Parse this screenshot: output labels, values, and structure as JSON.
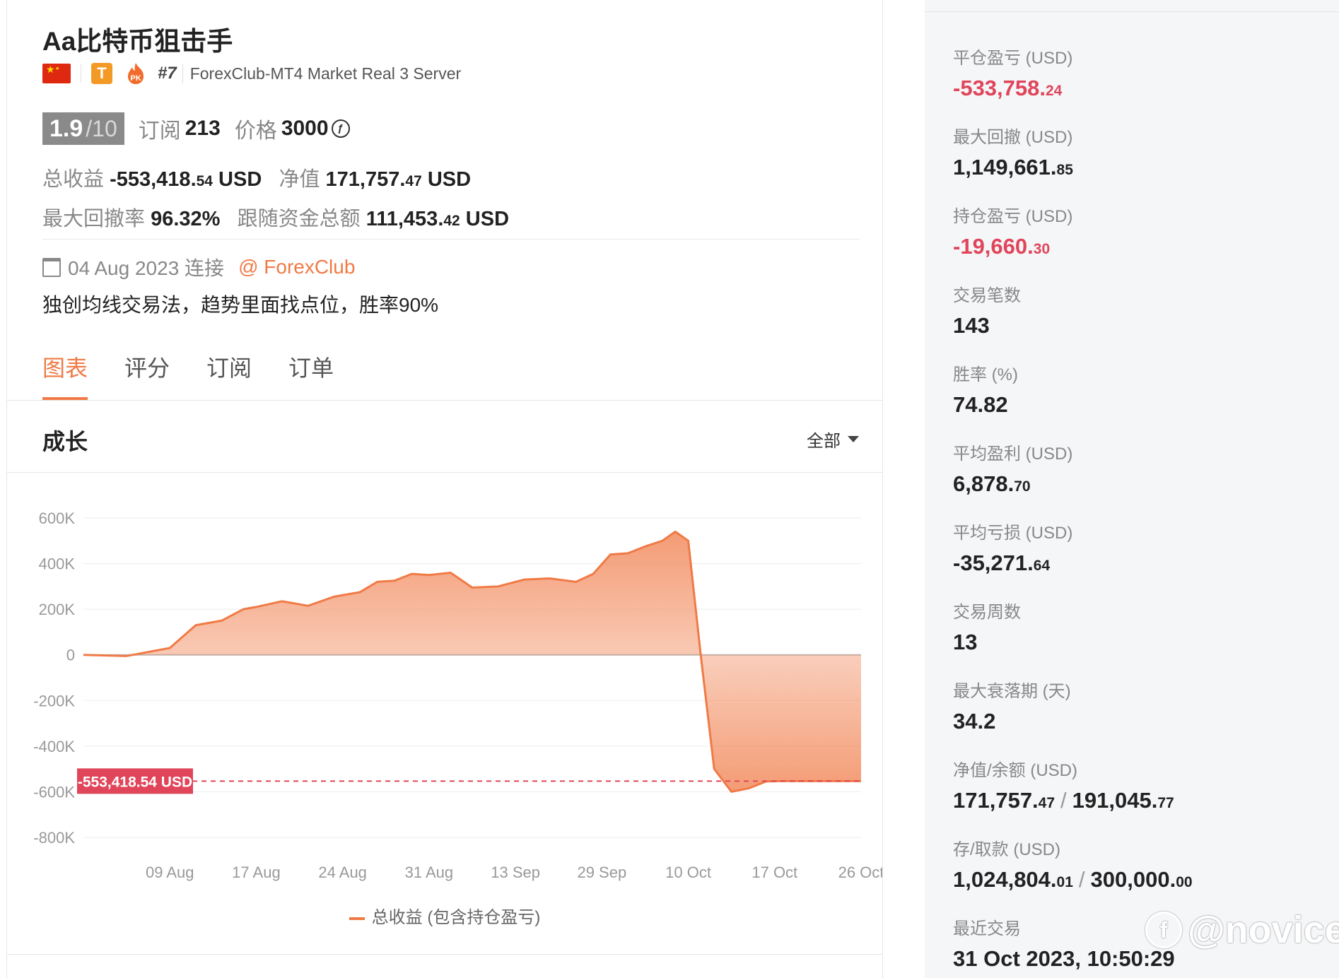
{
  "profile": {
    "title": "Aa比特币狙击手",
    "flag_icon": "china-flag-icon",
    "tier_badge": "T",
    "pk_badge": "PK",
    "rank": "#7",
    "server": "ForexClub-MT4 Market Real 3 Server",
    "score": "1.9",
    "score_max": "/10",
    "subscribe_label": "订阅",
    "subscribe_count": "213",
    "price_label": "价格",
    "price_value": "3000",
    "total_profit_label": "总收益",
    "total_profit_main": "-553,418.",
    "total_profit_dec": "54",
    "total_profit_unit": "USD",
    "equity_label": "净值",
    "equity_main": "171,757.",
    "equity_dec": "47",
    "equity_unit": "USD",
    "max_dd_label": "最大回撤率",
    "max_dd_value": "96.32%",
    "follow_funds_label": "跟随资金总额",
    "follow_funds_main": "111,453.",
    "follow_funds_dec": "42",
    "follow_funds_unit": "USD",
    "connect_date": "04 Aug 2023 连接",
    "broker": "@ ForexClub",
    "description": "独创均线交易法，趋势里面找点位，胜率90%"
  },
  "tabs": [
    "图表",
    "评分",
    "订阅",
    "订单"
  ],
  "active_tab": 0,
  "section": {
    "title": "成长",
    "range_label": "全部"
  },
  "colors": {
    "accent": "#f07a46",
    "negative": "#e0455a",
    "line": "#f07a46",
    "marker_bg": "#e0455a"
  },
  "chart_data": {
    "type": "area",
    "title": "",
    "xlabel": "",
    "ylabel": "",
    "ylim": [
      -800000,
      600000
    ],
    "yticks": [
      600000,
      400000,
      200000,
      0,
      -200000,
      -400000,
      -600000,
      -800000
    ],
    "ytick_labels": [
      "600K",
      "400K",
      "200K",
      "0",
      "-200K",
      "-400K",
      "-600K",
      "-800K"
    ],
    "xtick_labels": [
      "09 Aug",
      "17 Aug",
      "24 Aug",
      "31 Aug",
      "13 Sep",
      "29 Sep",
      "10 Oct",
      "17 Oct",
      "26 Oct"
    ],
    "series": [
      {
        "name": "总收益 (包含持仓盈亏)",
        "x": [
          0,
          0.5,
          1,
          1.3,
          1.6,
          1.85,
          2,
          2.3,
          2.6,
          2.9,
          3.2,
          3.4,
          3.6,
          3.8,
          4,
          4.25,
          4.5,
          4.8,
          5,
          5.1,
          5.4,
          5.7,
          5.9,
          6.1,
          6.3,
          6.5,
          6.7,
          6.85,
          7,
          7.15,
          7.3,
          7.5,
          7.7,
          7.9,
          8.05,
          8.15,
          8.2,
          8.3,
          8.5,
          8.7,
          8.9,
          9
        ],
        "y": [
          0,
          -5000,
          30000,
          130000,
          150000,
          200000,
          210000,
          235000,
          215000,
          255000,
          275000,
          320000,
          325000,
          355000,
          350000,
          360000,
          295000,
          300000,
          320000,
          330000,
          335000,
          320000,
          355000,
          440000,
          445000,
          475000,
          500000,
          540000,
          500000,
          -20000,
          -500000,
          -600000,
          -585000,
          -555000,
          -553418.54,
          -553418.54,
          -553418.54,
          -553418.54,
          -553418.54,
          -553418.54,
          -553418.54,
          -553418.54
        ]
      }
    ],
    "current_value_label": "-553,418.54 USD",
    "current_value": -553418.54
  },
  "legend_label": "总收益 (包含持仓盈亏)",
  "stats": [
    {
      "label": "平仓盈亏 (USD)",
      "main": "-533,758.",
      "dec": "24",
      "negative": true
    },
    {
      "label": "最大回撤 (USD)",
      "main": "1,149,661.",
      "dec": "85",
      "negative": false
    },
    {
      "label": "持仓盈亏 (USD)",
      "main": "-19,660.",
      "dec": "30",
      "negative": true
    },
    {
      "label": "交易笔数",
      "main": "143",
      "dec": "",
      "negative": false
    },
    {
      "label": "胜率 (%)",
      "main": "74.82",
      "dec": "",
      "negative": false
    },
    {
      "label": "平均盈利 (USD)",
      "main": "6,878.",
      "dec": "70",
      "negative": false
    },
    {
      "label": "平均亏损 (USD)",
      "main": "-35,271.",
      "dec": "64",
      "negative": false
    },
    {
      "label": "交易周数",
      "main": "13",
      "dec": "",
      "negative": false
    },
    {
      "label": "最大衰落期 (天)",
      "main": "34.2",
      "dec": "",
      "negative": false
    }
  ],
  "equity_balance": {
    "label": "净值/余额 (USD)",
    "a_main": "171,757.",
    "a_dec": "47",
    "b_main": "191,045.",
    "b_dec": "77"
  },
  "deposit_withdraw": {
    "label": "存/取款 (USD)",
    "a_main": "1,024,804.",
    "a_dec": "01",
    "b_main": "300,000.",
    "b_dec": "00"
  },
  "last_trade": {
    "label": "最近交易",
    "value": "31 Oct 2023, 10:50:29"
  },
  "watermark": "@novice"
}
